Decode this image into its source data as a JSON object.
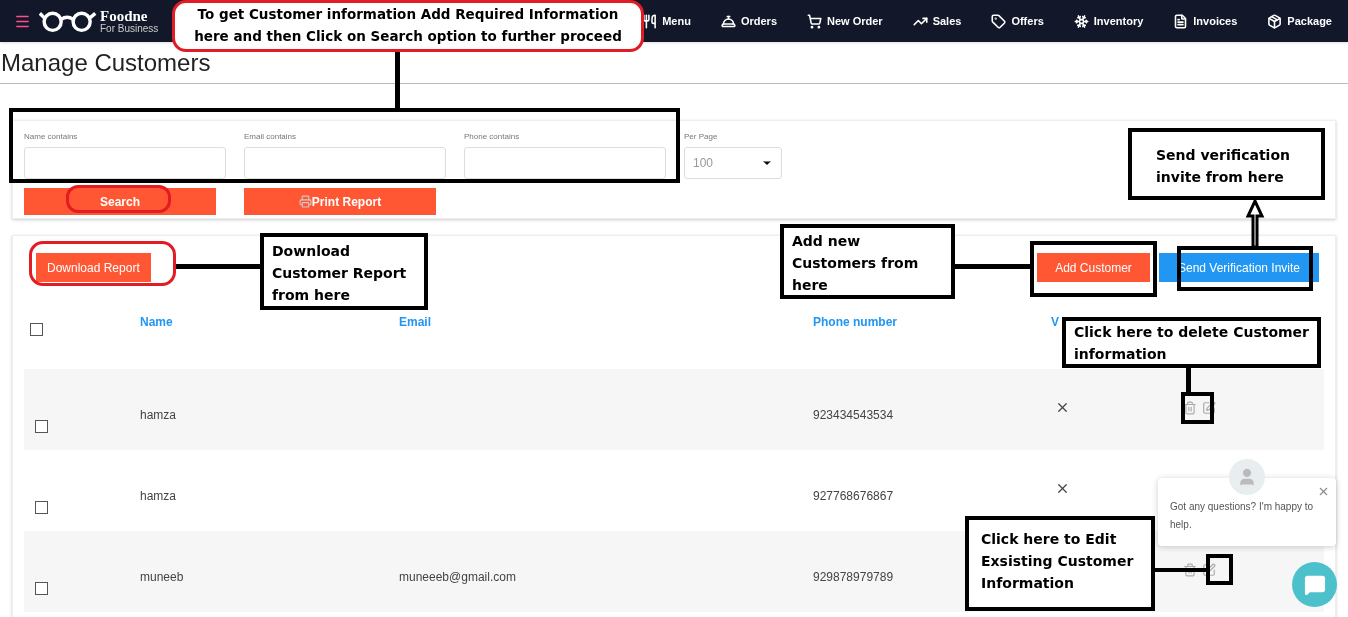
{
  "header": {
    "brand": "Foodne",
    "tagline": "For Business",
    "nav": [
      {
        "label": "Menu"
      },
      {
        "label": "Orders"
      },
      {
        "label": "New Order"
      },
      {
        "label": "Sales"
      },
      {
        "label": "Offers"
      },
      {
        "label": "Inventory"
      },
      {
        "label": "Invoices"
      },
      {
        "label": "Package"
      }
    ]
  },
  "page_title": "Manage Customers",
  "filters": {
    "fields": [
      {
        "label": "Name contains"
      },
      {
        "label": "Email contains"
      },
      {
        "label": "Phone contains"
      }
    ],
    "per_page": {
      "label": "Per Page",
      "value": "100"
    },
    "buttons": [
      {
        "label": "Search",
        "kind": "plain"
      },
      {
        "label": "Print Report",
        "kind": "print"
      }
    ]
  },
  "customers": {
    "download_button": "Download Report",
    "actions": [
      {
        "label": "Add Customer",
        "kind": "orange"
      },
      {
        "label": "Send Verification Invite",
        "kind": "blue"
      }
    ],
    "columns": [
      "Name",
      "Email",
      "Phone number",
      "V"
    ],
    "select_all": {
      "checked": false
    },
    "rows": [
      {
        "checked": false,
        "name": "hamza",
        "phone": "923434543534",
        "verified": false
      },
      {
        "checked": false,
        "name": "hamza",
        "phone": "927768676867",
        "verified": false
      },
      {
        "checked": false,
        "name": "muneeb",
        "email": "muneeeb@gmail.com",
        "phone": "929878979789"
      }
    ]
  },
  "chat": {
    "message": "Got any questions? I'm happy to help."
  },
  "annotations": [
    {
      "kind": "red",
      "text": "To get Customer information Add Required Information here and then Click on Search option to further proceed"
    },
    {
      "kind": "box",
      "text": "Download Customer Report from here"
    },
    {
      "kind": "box",
      "text": "Add new Customers from here"
    },
    {
      "kind": "box",
      "text": "Send verification invite from here"
    },
    {
      "kind": "box",
      "text": "Click here to delete Customer information"
    },
    {
      "kind": "box",
      "text": "Click here to Edit Exsisting Customer Information"
    }
  ]
}
